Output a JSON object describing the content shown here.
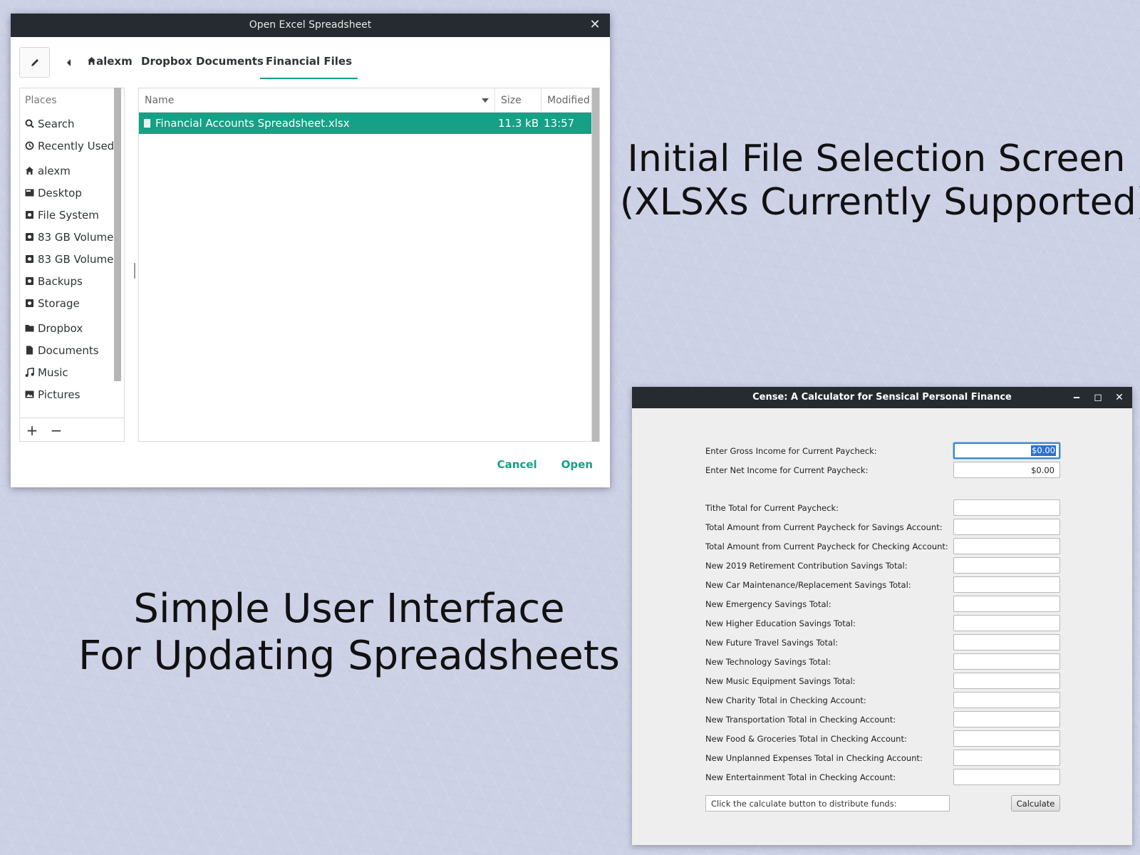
{
  "file_dialog": {
    "title": "Open Excel Spreadsheet",
    "breadcrumbs": [
      "alexm",
      "Dropbox",
      "Documents",
      "Financial Files"
    ],
    "places_header": "Places",
    "places": [
      {
        "label": "Search",
        "icon": "search-icon"
      },
      {
        "label": "Recently Used",
        "icon": "clock-icon"
      },
      {
        "label": "alexm",
        "icon": "home-icon"
      },
      {
        "label": "Desktop",
        "icon": "desktop-icon"
      },
      {
        "label": "File System",
        "icon": "drive-icon"
      },
      {
        "label": "83 GB Volume",
        "icon": "drive-icon"
      },
      {
        "label": "83 GB Volume",
        "icon": "drive-icon"
      },
      {
        "label": "Backups",
        "icon": "drive-icon"
      },
      {
        "label": "Storage",
        "icon": "drive-icon"
      },
      {
        "label": "Dropbox",
        "icon": "folder-icon"
      },
      {
        "label": "Documents",
        "icon": "document-icon"
      },
      {
        "label": "Music",
        "icon": "music-icon"
      },
      {
        "label": "Pictures",
        "icon": "image-icon"
      }
    ],
    "columns": {
      "name": "Name",
      "size": "Size",
      "modified": "Modified"
    },
    "files": [
      {
        "name": "Financial Accounts Spreadsheet.xlsx",
        "size": "11.3 kB",
        "modified": "13:57",
        "selected": true
      }
    ],
    "buttons": {
      "cancel": "Cancel",
      "open": "Open"
    },
    "accent_color": "#16a085"
  },
  "captions": {
    "top_line1": "Initial File Selection Screen",
    "top_line2": "(XLSXs Currently Supported)",
    "bottom_line1": "Simple User Interface",
    "bottom_line2": "For Updating Spreadsheets"
  },
  "calculator": {
    "title": "Cense: A Calculator for Sensical Personal Finance",
    "income_fields": [
      {
        "label": "Enter Gross Income for Current Paycheck:",
        "value": "$0.00",
        "focused": true
      },
      {
        "label": "Enter Net Income for Current Paycheck:",
        "value": "$0.00",
        "focused": false
      }
    ],
    "fields": [
      {
        "label": "Tithe Total for Current Paycheck:",
        "value": ""
      },
      {
        "label": "Total Amount from Current Paycheck for Savings Account:",
        "value": ""
      },
      {
        "label": "Total Amount from Current Paycheck for Checking Account:",
        "value": ""
      },
      {
        "label": "New 2019 Retirement Contribution Savings Total:",
        "value": ""
      },
      {
        "label": "New Car Maintenance/Replacement Savings Total:",
        "value": ""
      },
      {
        "label": "New Emergency Savings Total:",
        "value": ""
      },
      {
        "label": "New Higher Education Savings Total:",
        "value": ""
      },
      {
        "label": "New Future Travel Savings Total:",
        "value": ""
      },
      {
        "label": "New Technology Savings Total:",
        "value": ""
      },
      {
        "label": "New Music Equipment Savings Total:",
        "value": ""
      },
      {
        "label": "New Charity Total in Checking Account:",
        "value": ""
      },
      {
        "label": "New Transportation Total in Checking Account:",
        "value": ""
      },
      {
        "label": "New Food & Groceries Total in Checking Account:",
        "value": ""
      },
      {
        "label": "New Unplanned Expenses Total in Checking Account:",
        "value": ""
      },
      {
        "label": "New Entertainment Total in Checking Account:",
        "value": ""
      }
    ],
    "status_text": "Click the calculate button to distribute funds:",
    "calculate_label": "Calculate"
  }
}
